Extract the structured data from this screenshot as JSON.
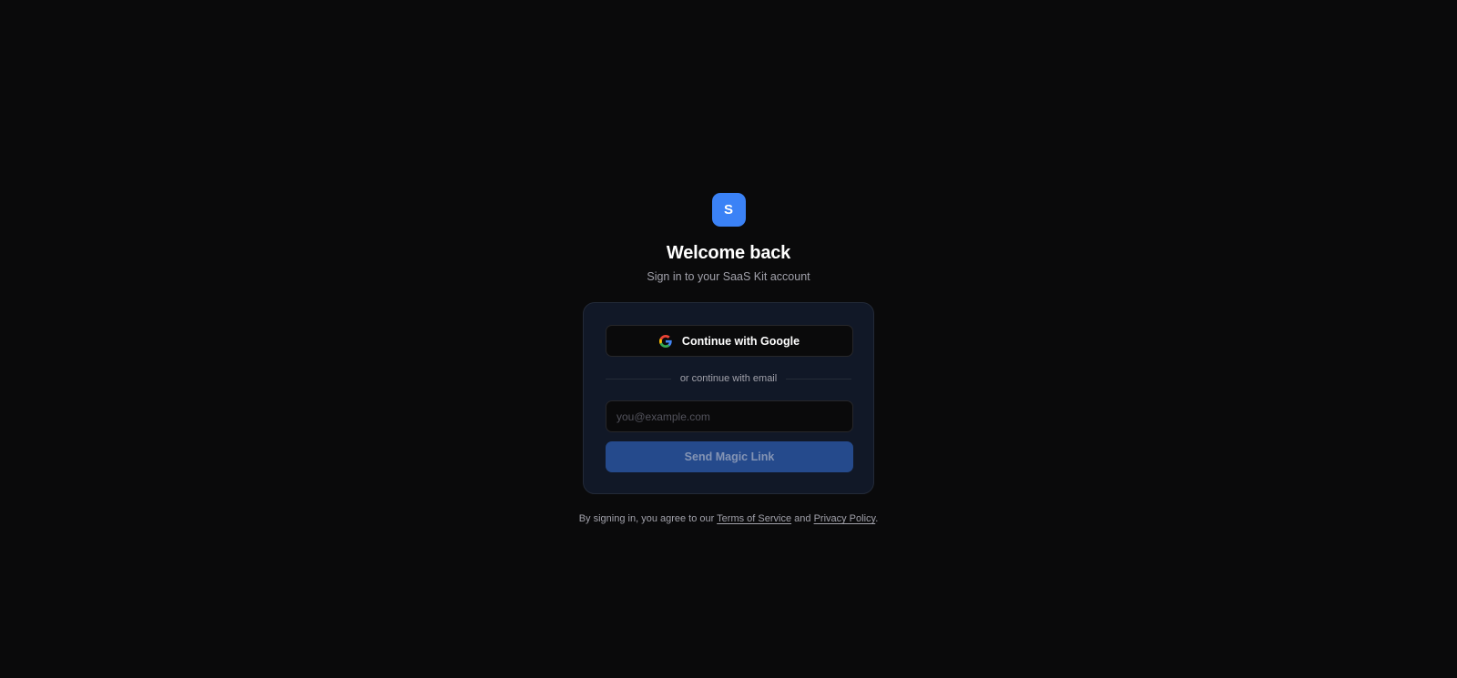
{
  "brand": {
    "logo_letter": "S",
    "logo_color": "#3b82f6"
  },
  "header": {
    "title": "Welcome back",
    "subtitle": "Sign in to your SaaS Kit account"
  },
  "auth": {
    "google_label": "Continue with Google",
    "google_icon": "google-icon",
    "divider_text": "or continue with email",
    "email_placeholder": "you@example.com",
    "email_value": "",
    "submit_label": "Send Magic Link",
    "submit_color": "#254a8c"
  },
  "footer": {
    "prefix": "By signing in, you agree to our ",
    "terms_label": "Terms of Service",
    "middle": " and ",
    "privacy_label": "Privacy Policy",
    "suffix": "."
  }
}
